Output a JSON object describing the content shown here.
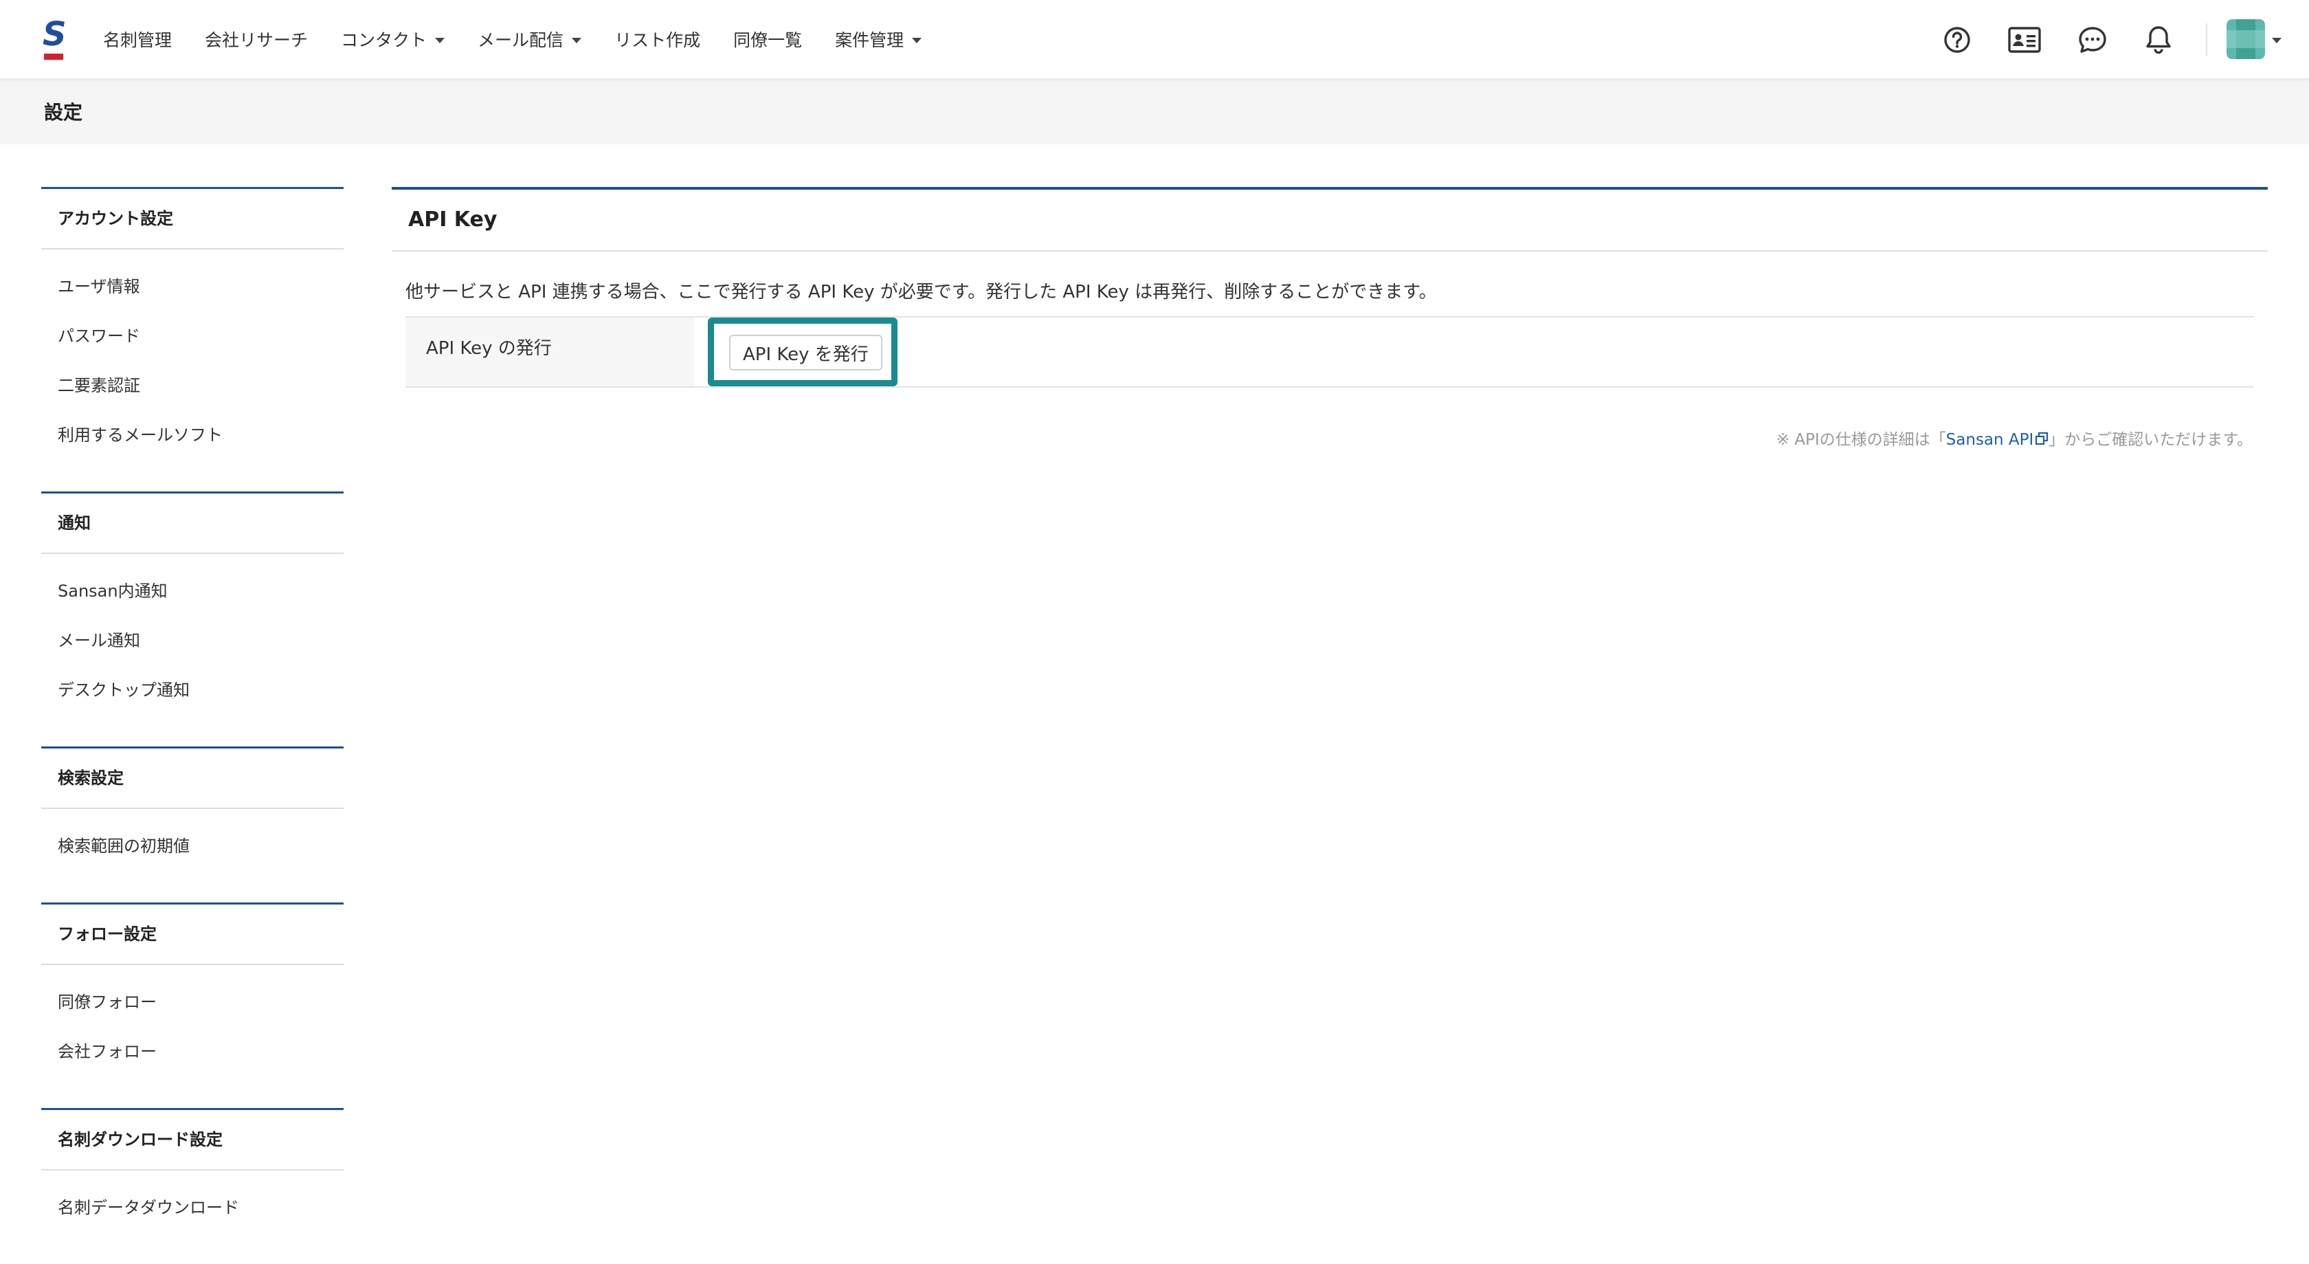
{
  "header": {
    "logo_letter": "S",
    "nav": [
      {
        "label": "名刺管理",
        "dropdown": false
      },
      {
        "label": "会社リサーチ",
        "dropdown": false
      },
      {
        "label": "コンタクト",
        "dropdown": true
      },
      {
        "label": "メール配信",
        "dropdown": true
      },
      {
        "label": "リスト作成",
        "dropdown": false
      },
      {
        "label": "同僚一覧",
        "dropdown": false
      },
      {
        "label": "案件管理",
        "dropdown": true
      }
    ],
    "icons": [
      "help-icon",
      "business-card-icon",
      "chat-icon",
      "bell-icon"
    ]
  },
  "page_title": "設定",
  "sidebar": {
    "sections": [
      {
        "title": "アカウント設定",
        "items": [
          "ユーザ情報",
          "パスワード",
          "二要素認証",
          "利用するメールソフト"
        ]
      },
      {
        "title": "通知",
        "items": [
          "Sansan内通知",
          "メール通知",
          "デスクトップ通知"
        ]
      },
      {
        "title": "検索設定",
        "items": [
          "検索範囲の初期値"
        ]
      },
      {
        "title": "フォロー設定",
        "items": [
          "同僚フォロー",
          "会社フォロー"
        ]
      },
      {
        "title": "名刺ダウンロード設定",
        "items": [
          "名刺データダウンロード"
        ]
      }
    ]
  },
  "main": {
    "title": "API Key",
    "description": "他サービスと API 連携する場合、ここで発行する API Key が必要です。発行した API Key は再発行、削除することができます。",
    "row_label": "API Key の発行",
    "issue_button": "API Key を発行",
    "note_prefix": "※ APIの仕様の詳細は「",
    "note_link": "Sansan API",
    "note_suffix": "」からご確認いただけます。"
  },
  "colors": {
    "brand_blue": "#1d5290",
    "logo_red": "#d5202a",
    "highlight_teal": "#1a8b8e",
    "link_blue": "#1d5fb0"
  }
}
